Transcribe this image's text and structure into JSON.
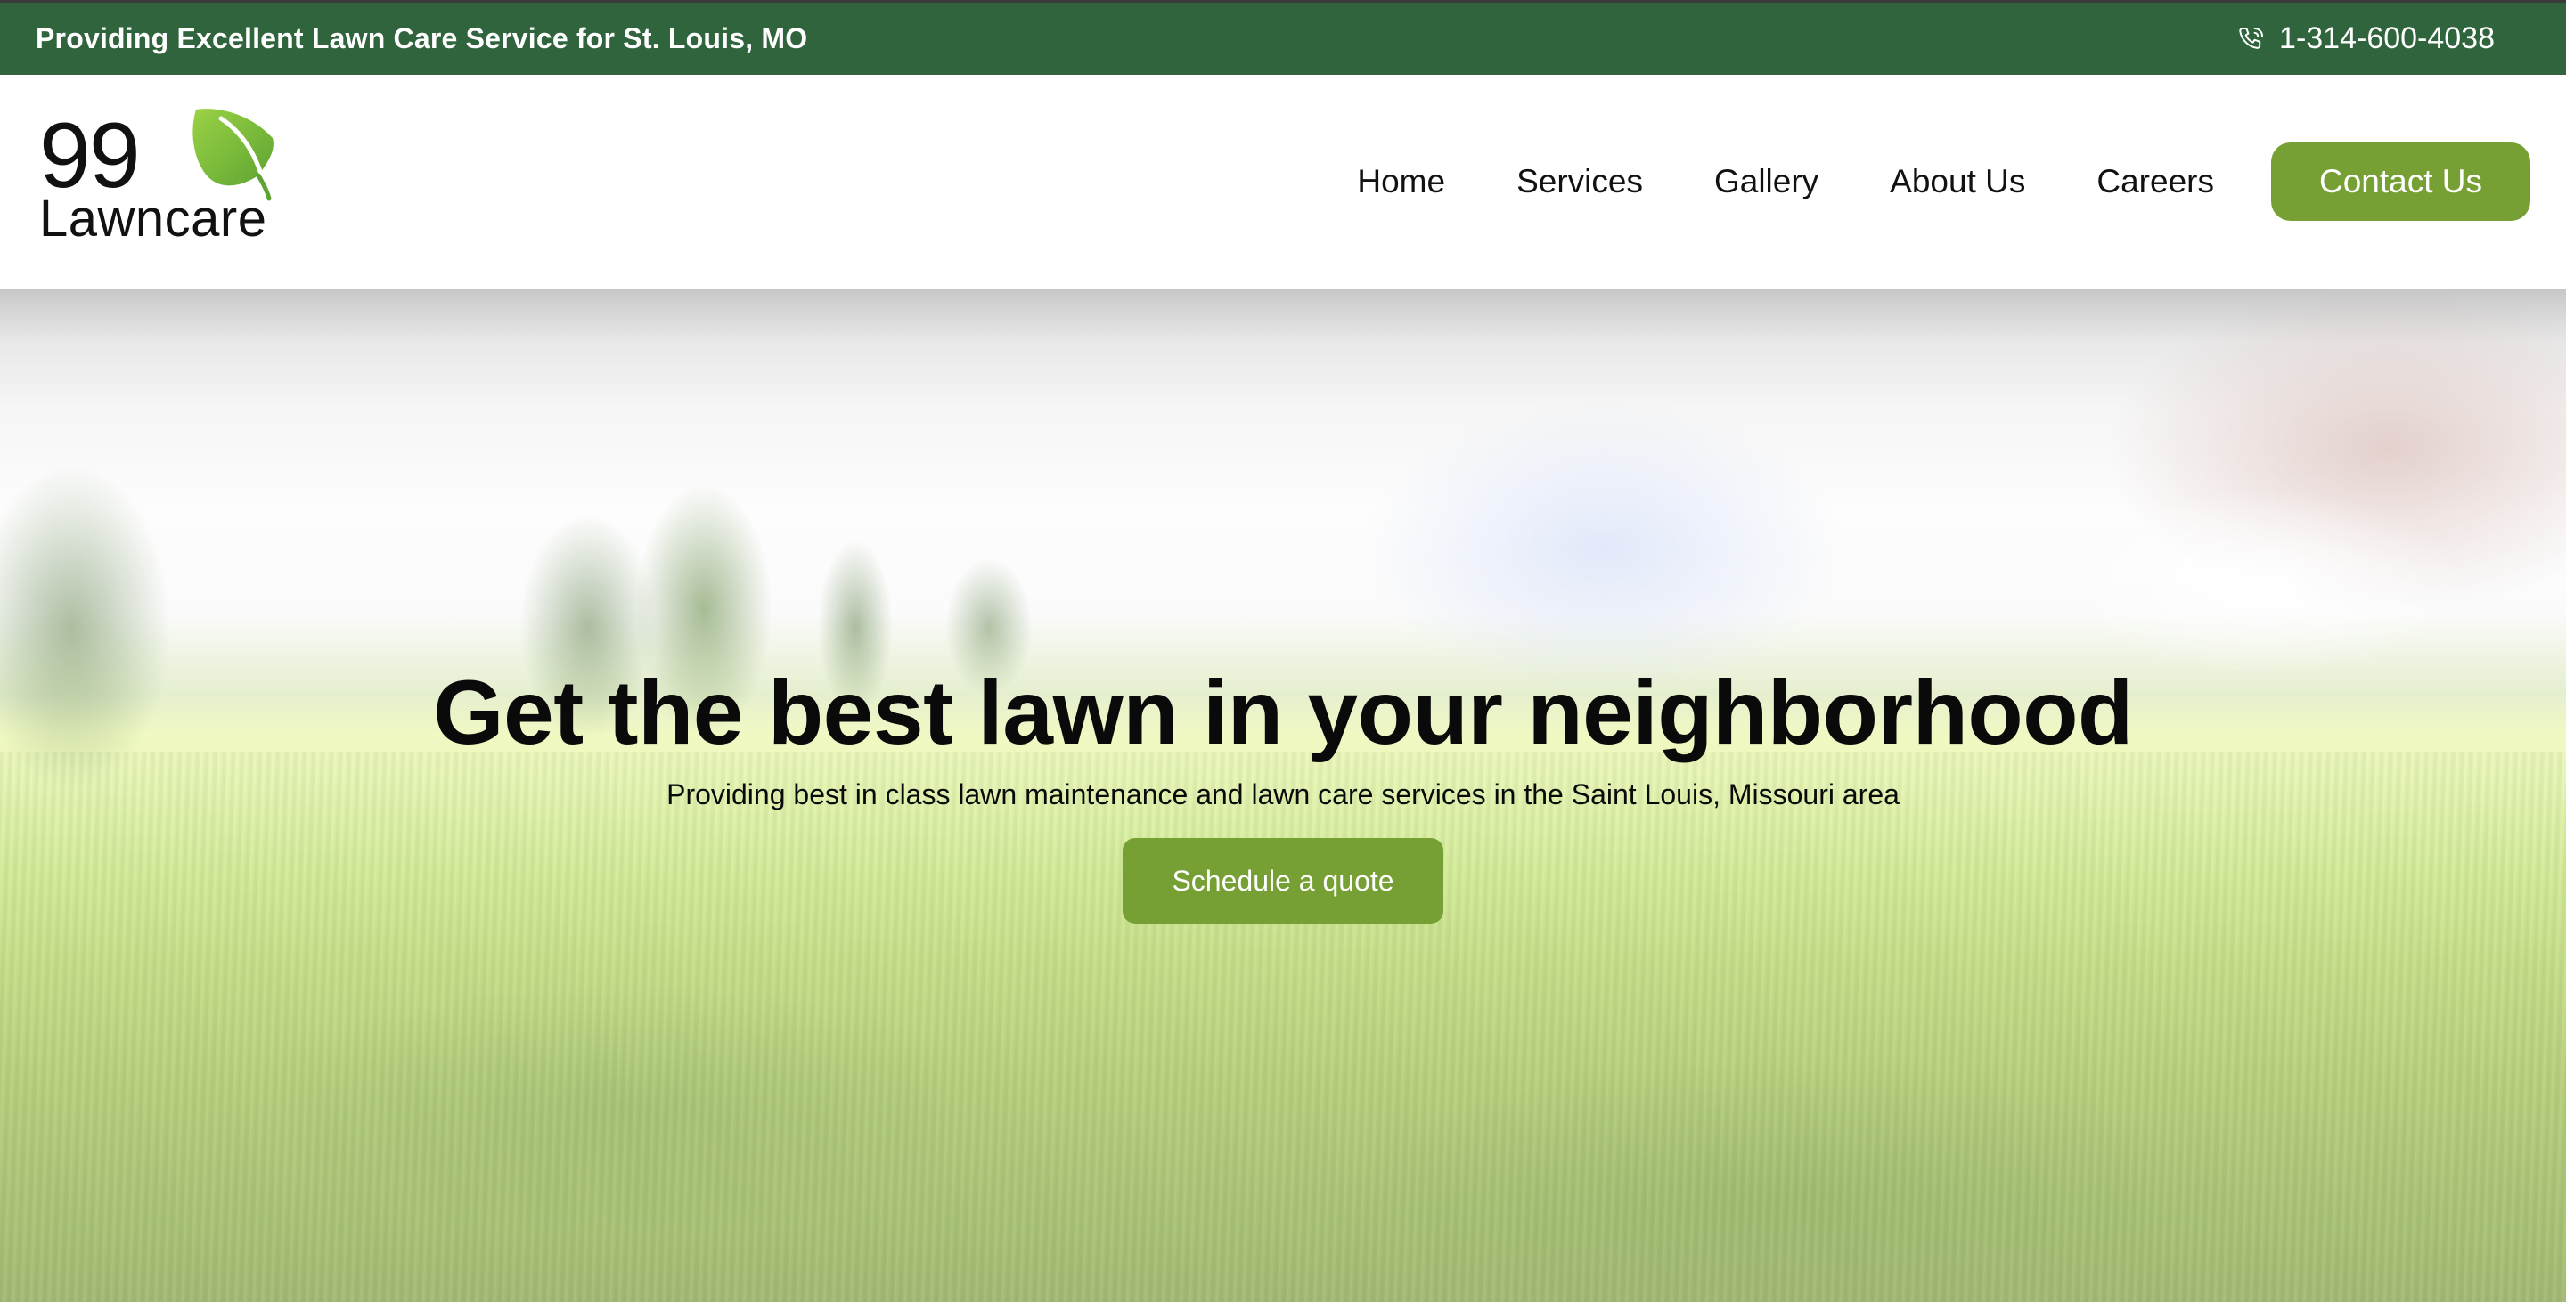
{
  "topbar": {
    "tagline": "Providing Excellent Lawn Care Service for St. Louis, MO",
    "phone_icon": "phone-ringing-icon",
    "phone": "1-314-600-4038"
  },
  "header": {
    "logo": {
      "number": "99",
      "word": "Lawncare",
      "icon": "leaf-icon"
    },
    "nav": [
      {
        "label": "Home"
      },
      {
        "label": "Services"
      },
      {
        "label": "Gallery"
      },
      {
        "label": "About Us"
      },
      {
        "label": "Careers"
      }
    ],
    "contact_label": "Contact Us"
  },
  "hero": {
    "title": "Get the best lawn in your neighborhood",
    "subtitle": "Providing best in class lawn maintenance and lawn care services in the Saint Louis, Missouri area",
    "cta_label": "Schedule a quote",
    "background_image": "blurred lawn with houses"
  },
  "colors": {
    "topbar_bg": "#30643c",
    "accent": "#76a033",
    "text": "#0a0a0a"
  }
}
